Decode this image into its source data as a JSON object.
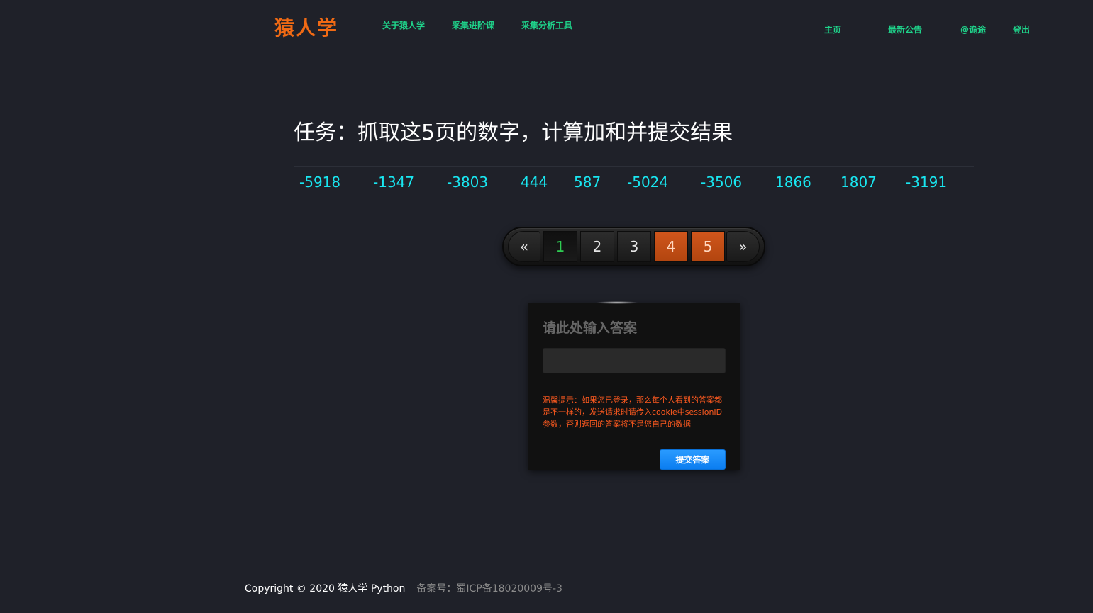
{
  "header": {
    "logo": "猿人学",
    "nav_left": [
      "关于猿人学",
      "采集进阶课",
      "采集分析工具"
    ],
    "nav_right": {
      "home": "主页",
      "news": "最新公告",
      "user": "@诡途",
      "logout": "登出"
    }
  },
  "task": {
    "title": "任务：抓取这5页的数字，计算加和并提交结果",
    "numbers": [
      "-5918",
      "-1347",
      "-3803",
      "444",
      "587",
      "-5024",
      "-3506",
      "1866",
      "1807",
      "-3191"
    ]
  },
  "pagination": {
    "prev": "«",
    "pages": [
      "1",
      "2",
      "3",
      "4",
      "5"
    ],
    "next": "»",
    "current_page": "1",
    "highlighted_pages": [
      "4",
      "5"
    ]
  },
  "answer": {
    "title": "请此处输入答案",
    "input_value": "",
    "tip": "温馨提示：如果您已登录，那么每个人看到的答案都是不一样的，发送请求时请传入cookie中sessionID参数，否则返回的答案将不是您自己的数据",
    "submit_label": "提交答案"
  },
  "footer": {
    "copyright": "Copyright © 2020 猿人学 Python",
    "icp": "备案号：蜀ICP备18020009号-3"
  },
  "colors": {
    "background": "#1f2129",
    "logo": "#f06a14",
    "nav": "#1fd28a",
    "numbers": "#19e6f0",
    "tip": "#ff5a1f",
    "submit": "#0b7df0",
    "page_highlight": "#c04d14"
  }
}
